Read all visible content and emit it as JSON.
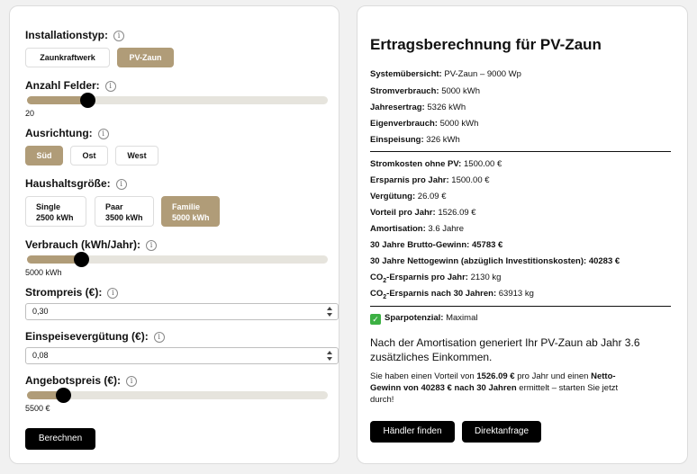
{
  "form": {
    "installation_type": {
      "label": "Installationstyp:",
      "options": [
        "Zaunkraftwerk",
        "PV-Zaun"
      ],
      "selected": "PV-Zaun"
    },
    "panel_count": {
      "label": "Anzahl Felder:",
      "value": "20",
      "fraction": 0.2
    },
    "orientation": {
      "label": "Ausrichtung:",
      "options": [
        "Süd",
        "Ost",
        "West"
      ],
      "selected": "Süd"
    },
    "household": {
      "label": "Haushaltsgröße:",
      "options": [
        {
          "title": "Single",
          "sub": "2500 kWh"
        },
        {
          "title": "Paar",
          "sub": "3500 kWh"
        },
        {
          "title": "Familie",
          "sub": "5000 kWh"
        }
      ],
      "selected": "Familie"
    },
    "consumption": {
      "label": "Verbrauch (kWh/Jahr):",
      "value": "5000 kWh",
      "fraction": 0.18
    },
    "price": {
      "label": "Strompreis (€):",
      "value": "0,30"
    },
    "feed_in": {
      "label": "Einspeisevergütung (€):",
      "value": "0,08"
    },
    "offer": {
      "label": "Angebotspreis (€):",
      "value": "5500 €",
      "fraction": 0.12
    },
    "calculate_label": "Berechnen",
    "info_glyph": "i"
  },
  "result": {
    "title": "Ertragsberechnung für PV-Zaun",
    "summary": [
      {
        "key": "Systemübersicht:",
        "value": "PV-Zaun – 9000 Wp"
      },
      {
        "key": "Stromverbrauch:",
        "value": "5000 kWh"
      },
      {
        "key": "Jahresertrag:",
        "value": "5326 kWh"
      },
      {
        "key": "Eigenverbrauch:",
        "value": "5000 kWh"
      },
      {
        "key": "Einspeisung:",
        "value": "326 kWh"
      }
    ],
    "finance": [
      {
        "key": "Stromkosten ohne PV:",
        "value": "1500.00 €"
      },
      {
        "key": "Ersparnis pro Jahr:",
        "value": "1500.00 €"
      },
      {
        "key": "Vergütung:",
        "value": "26.09 €"
      },
      {
        "key": "Vorteil pro Jahr:",
        "value": "1526.09 €"
      },
      {
        "key": "Amortisation:",
        "value": "3.6 Jahre"
      },
      {
        "key": "30 Jahre Brutto-Gewinn:",
        "value": "45783 €",
        "bold_value": true
      },
      {
        "key": "30 Jahre Nettogewinn (abzüglich Investitionskosten):",
        "value": "40283 €",
        "bold_value": true
      }
    ],
    "co2_year": {
      "key_pre": "CO",
      "key_sub": "2",
      "key_post": "-Ersparnis pro Jahr:",
      "value": "2130 kg"
    },
    "co2_30": {
      "key_pre": "CO",
      "key_sub": "2",
      "key_post": "-Ersparnis nach 30 Jahren:",
      "value": "63913 kg"
    },
    "potential": {
      "check_glyph": "✓",
      "key": "Sparpotenzial:",
      "value": "Maximal"
    },
    "amort_line1": "Nach der Amortisation generiert Ihr PV-Zaun ab Jahr 3.6",
    "amort_line2": "zusätzliches Einkommen.",
    "advantage": {
      "p1": "Sie haben einen Vorteil von ",
      "b1": "1526.09 €",
      "p2": " pro Jahr und einen ",
      "b2a": "Netto-",
      "b2b": "Gewinn von 40283 € nach 30 Jahren",
      "p3": " ermittelt – starten Sie jetzt",
      "p4": "durch!"
    },
    "dealer_button": "Händler finden",
    "request_button": "Direktanfrage"
  },
  "colors": {
    "accent": "#b09c78",
    "track": "#e6e4dd",
    "button_dark": "#000000",
    "check_green": "#3cb043"
  }
}
